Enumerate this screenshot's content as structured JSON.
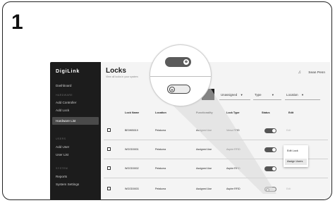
{
  "step": {
    "number": "1"
  },
  "sidebar": {
    "logo": "DigiLink",
    "items": [
      {
        "label": "Dashboard",
        "type": "item"
      },
      {
        "label": "HARDWARE",
        "type": "section"
      },
      {
        "label": "Add Controller",
        "type": "item"
      },
      {
        "label": "Add Lock",
        "type": "item"
      },
      {
        "label": "Hardware List",
        "type": "item",
        "active": true
      },
      {
        "label": "USERS",
        "type": "section"
      },
      {
        "label": "Add User",
        "type": "item"
      },
      {
        "label": "User List",
        "type": "item"
      },
      {
        "label": "SYSTEM",
        "type": "section"
      },
      {
        "label": "Reports",
        "type": "item"
      },
      {
        "label": "System Settings",
        "type": "item"
      }
    ]
  },
  "header": {
    "title": "Locks",
    "subtitle": "View all locks in your system",
    "user_name": "Sean Penn",
    "bell_icon": "bell-icon"
  },
  "filters": {
    "assignment": "Unassigned",
    "type": "Type",
    "location": "Location",
    "chevron": "▾"
  },
  "table": {
    "columns": [
      "Lock Name",
      "Location",
      "Functionality",
      "Lock Type",
      "Status",
      "Edit"
    ],
    "rows": [
      {
        "name": "BE0HIB019",
        "location": "Petaluma",
        "functionality": "Assigned Use",
        "lock_type": "Versa RFID",
        "status": "on",
        "edit": "Edit"
      },
      {
        "name": "WOOD0001",
        "location": "Petaluma",
        "functionality": "Assigned Use",
        "lock_type": "Aspire RFID",
        "status": "on",
        "edit": ""
      },
      {
        "name": "WOOD0002",
        "location": "Petaluma",
        "functionality": "Assigned Use",
        "lock_type": "Aspire RFID",
        "status": "on",
        "edit": ""
      },
      {
        "name": "WOOD0003",
        "location": "Petaluma",
        "functionality": "Assigned Use",
        "lock_type": "Aspire RFID",
        "status": "off",
        "edit": "Edit"
      }
    ]
  },
  "dropdown": {
    "items": [
      {
        "label": "Edit Lock"
      },
      {
        "label": "Assign Users",
        "active": true
      }
    ]
  },
  "zoom": {
    "toggle_on_glyph": "⊕",
    "toggle_off_glyph": "⊖"
  },
  "colors": {
    "sidebar_bg": "#1c1c1c",
    "toggle_on": "#555555",
    "beam": "#d9d9d9"
  }
}
